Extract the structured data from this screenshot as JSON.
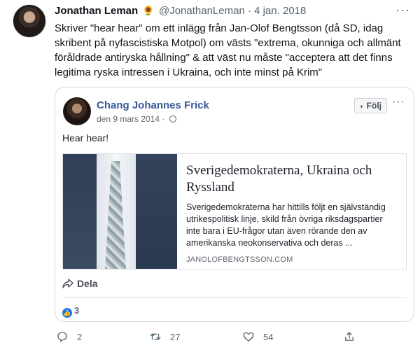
{
  "tweet": {
    "author_name": "Jonathan Leman",
    "author_emoji": "🌻",
    "handle": "@JonathanLeman",
    "separator": "·",
    "date": "4 jan. 2018",
    "text": "Skriver \"hear hear\" om ett inlägg från Jan-Olof Bengtsson (då SD, idag skribent på nyfascistiska Motpol) om västs \"extrema, okunniga och allmänt föråldrade antiryska hållning\" & att väst nu måste \"acceptera att det finns legitima ryska intressen i Ukraina, och inte minst på Krim\"",
    "more_icon": "more-horizontal-icon"
  },
  "embedded_post": {
    "author_name": "Chang Johannes Frick",
    "date": "den 9 mars 2014",
    "follow_label": "Följ",
    "post_text": "Hear hear!",
    "link": {
      "title": "Sverigedemokraterna, Ukraina och Ryssland",
      "description": "Sverigedemokraterna har hittills följt en självständig utrikespolitisk linje, skild från övriga riksdagspartier inte bara i EU-frågor utan även rörande den av amerikanska neokonservativa och deras ...",
      "domain": "JANOLOFBENGTSSON.COM"
    },
    "share_label": "Dela",
    "reactions_count": "3",
    "accent_color": "#385898",
    "like_color": "#1877f2"
  },
  "actions": {
    "reply_count": "2",
    "retweet_count": "27",
    "like_count": "54",
    "share_count": ""
  }
}
